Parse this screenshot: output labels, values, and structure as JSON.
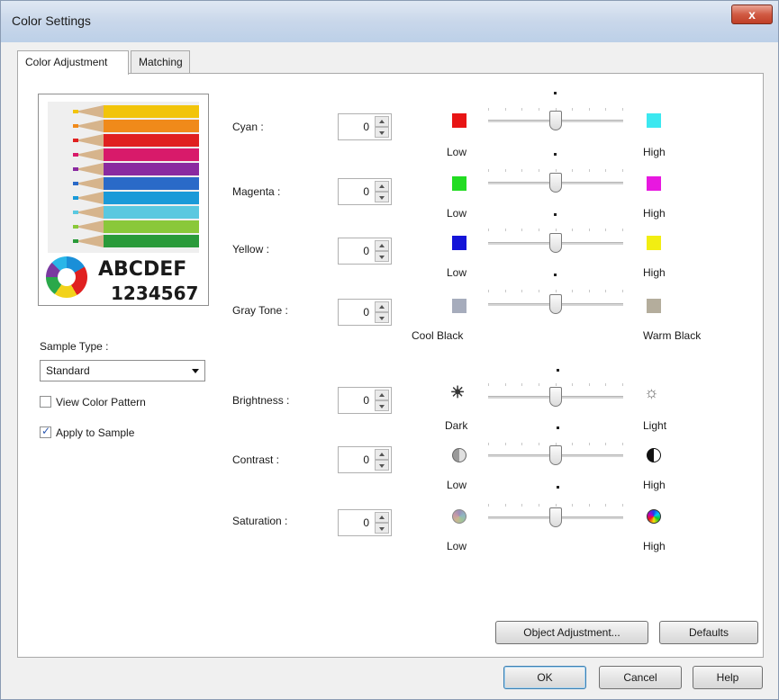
{
  "window": {
    "title": "Color Settings",
    "close_label": "x"
  },
  "tabs": [
    {
      "label": "Color Adjustment",
      "active": true
    },
    {
      "label": "Matching",
      "active": false
    }
  ],
  "preview": {
    "line1": "ABCDEF",
    "line2": "1234567"
  },
  "sample_type": {
    "label": "Sample Type :",
    "selected": "Standard"
  },
  "checkboxes": {
    "view_color_pattern": {
      "label": "View Color Pattern",
      "checked": false
    },
    "apply_to_sample": {
      "label": "Apply to Sample",
      "checked": true
    }
  },
  "color_rows": [
    {
      "label": "Cyan :",
      "value": "0",
      "low_label": "Low",
      "high_label": "High",
      "low_color": "#e81515",
      "high_color": "#3ce8f0",
      "level": 0.5
    },
    {
      "label": "Magenta :",
      "value": "0",
      "low_label": "Low",
      "high_label": "High",
      "low_color": "#22dc22",
      "high_color": "#e818e0",
      "level": 0.5
    },
    {
      "label": "Yellow :",
      "value": "0",
      "low_label": "Low",
      "high_label": "High",
      "low_color": "#1414d8",
      "high_color": "#f2ee12",
      "level": 0.5
    },
    {
      "label": "Gray Tone :",
      "value": "0",
      "low_label": "Cool Black",
      "high_label": "Warm Black",
      "low_color": "#a6acbc",
      "high_color": "#b4ad9c",
      "level": 0.5
    }
  ],
  "image_rows": [
    {
      "label": "Brightness :",
      "value": "0",
      "low_label": "Dark",
      "high_label": "Light",
      "low_icon": "sun-dark-icon",
      "high_icon": "sun-light-icon",
      "level": 0.5
    },
    {
      "label": "Contrast :",
      "value": "0",
      "low_label": "Low",
      "high_label": "High",
      "low_icon": "contrast-low-icon",
      "high_icon": "contrast-high-icon",
      "level": 0.5
    },
    {
      "label": "Saturation :",
      "value": "0",
      "low_label": "Low",
      "high_label": "High",
      "low_icon": "saturation-low-icon",
      "high_icon": "saturation-high-icon",
      "level": 0.5
    }
  ],
  "buttons": {
    "object_adjustment": "Object Adjustment...",
    "defaults": "Defaults",
    "ok": "OK",
    "cancel": "Cancel",
    "help": "Help"
  },
  "pencil_colors": [
    "#f2c40a",
    "#f08a1a",
    "#e02020",
    "#d81a6a",
    "#8a2aa0",
    "#2a6ac8",
    "#1a9ad8",
    "#5ac8e0",
    "#8ac83a",
    "#2a9a3a"
  ]
}
